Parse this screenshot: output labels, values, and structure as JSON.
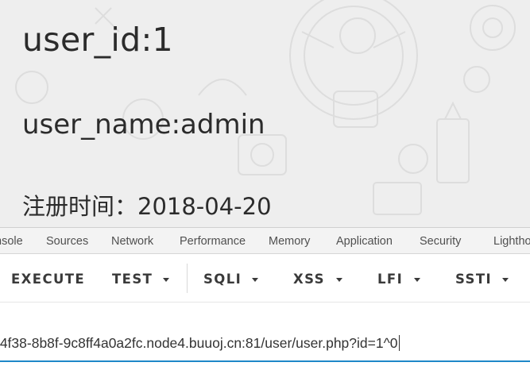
{
  "page": {
    "user_id": "user_id:1",
    "user_name": "user_name:admin",
    "register_time": "注册时间：2018-04-20"
  },
  "devtools": {
    "tabs": [
      "nsole",
      "Sources",
      "Network",
      "Performance",
      "Memory",
      "Application",
      "Security",
      "Lightho"
    ]
  },
  "toolbar": {
    "execute": "EXECUTE",
    "test": "TEST",
    "sqli": "SQLI",
    "xss": "XSS",
    "lfi": "LFI",
    "ssti": "SSTI"
  },
  "url": {
    "value": "-4f38-8b8f-9c8ff4a0a2fc.node4.buuoj.cn:81/user/user.php?id=1^0"
  },
  "colors": {
    "page_bg": "#eeeeee",
    "text": "#2b2b2b",
    "accent": "#1e88c8"
  }
}
